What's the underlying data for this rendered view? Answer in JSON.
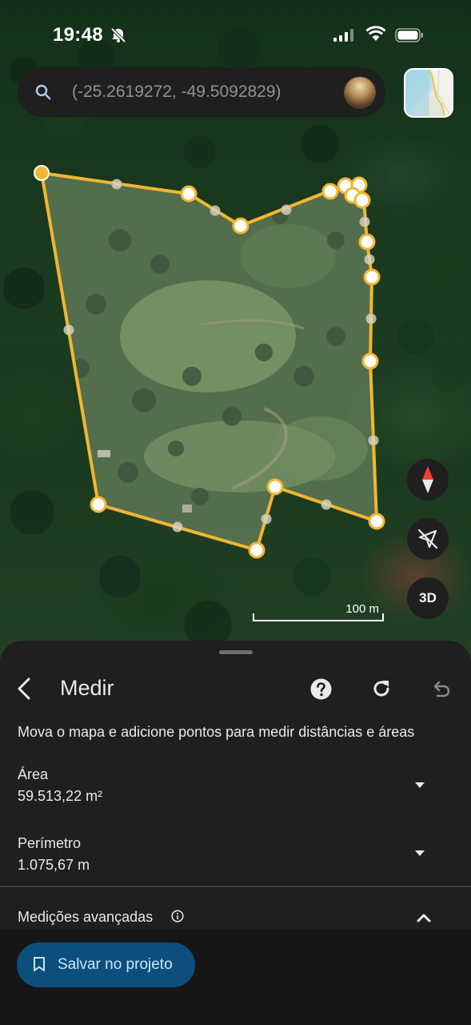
{
  "status_bar": {
    "time": "19:48"
  },
  "search": {
    "placeholder": "(-25.2619272, -49.5092829)"
  },
  "map": {
    "scale_label": "100 m",
    "three_d_label": "3D"
  },
  "measure_panel": {
    "title": "Medir",
    "instruction": "Mova o mapa e adicione pontos para medir distâncias e áreas",
    "area_label": "Área",
    "area_value": "59.513,22 m²",
    "perimeter_label": "Perímetro",
    "perimeter_value": "1.075,67 m",
    "advanced_label": "Medições avançadas",
    "save_label": "Salvar no projeto"
  },
  "colors": {
    "polygon_stroke": "#f2b632",
    "save_button": "#0c4f7c",
    "sheet_background": "#1f1f1f"
  },
  "icons": [
    "silent-bell-icon",
    "signal-icon",
    "wifi-icon",
    "battery-icon",
    "search-icon",
    "compass-icon",
    "location-off-icon",
    "back-arrow-icon",
    "help-icon",
    "refresh-icon",
    "undo-icon",
    "caret-down-icon",
    "info-icon",
    "chevron-up-icon",
    "bookmark-icon"
  ]
}
